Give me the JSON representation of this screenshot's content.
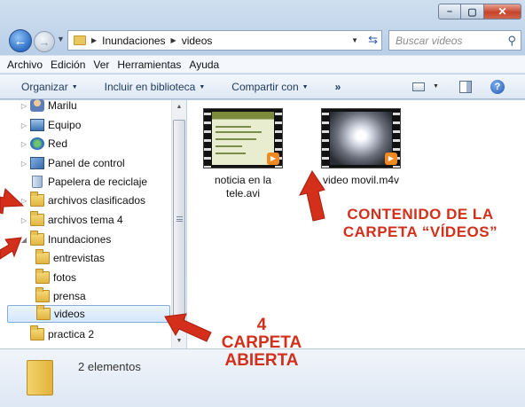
{
  "window": {
    "caption_buttons": [
      "minimize-icon",
      "maximize-icon",
      "close-icon"
    ]
  },
  "nav": {
    "address_path": [
      "Inundaciones",
      "videos"
    ],
    "search_placeholder": "Buscar videos"
  },
  "menubar": [
    "Archivo",
    "Edición",
    "Ver",
    "Herramientas",
    "Ayuda"
  ],
  "commandbar": {
    "organize": "Organizar",
    "include": "Incluir en biblioteca",
    "share": "Compartir con",
    "more": "»"
  },
  "tree": {
    "items": [
      {
        "label": "Marilu",
        "icon": "user-icon"
      },
      {
        "label": "Equipo",
        "icon": "computer-icon"
      },
      {
        "label": "Red",
        "icon": "network-icon"
      },
      {
        "label": "Panel de control",
        "icon": "control-panel-icon"
      },
      {
        "label": "Papelera de reciclaje",
        "icon": "recycle-bin-icon"
      },
      {
        "label": "archivos clasificados",
        "icon": "folder-icon"
      },
      {
        "label": "archivos tema 4",
        "icon": "folder-icon"
      },
      {
        "label": "Inundaciones",
        "icon": "folder-icon",
        "expanded": true
      },
      {
        "label": "entrevistas",
        "icon": "folder-icon"
      },
      {
        "label": "fotos",
        "icon": "folder-icon"
      },
      {
        "label": "prensa",
        "icon": "folder-icon"
      },
      {
        "label": "videos",
        "icon": "folder-icon",
        "selected": true
      },
      {
        "label": "practica 2",
        "icon": "folder-icon"
      }
    ]
  },
  "files": [
    {
      "name_line1": "noticia en la",
      "name_line2": "tele.avi"
    },
    {
      "name_line1": "video movil.m4v",
      "name_line2": ""
    }
  ],
  "details": {
    "count": "2 elementos"
  },
  "annotations": {
    "content_line1": "CONTENIDO DE LA",
    "content_line2": "CARPETA “VÍDEOS”",
    "open_line1": "4",
    "open_line2": "CARPETA",
    "open_line3": "ABIERTA"
  },
  "colors": {
    "annotation": "#d32f1a",
    "accent": "#2d6fc6"
  }
}
